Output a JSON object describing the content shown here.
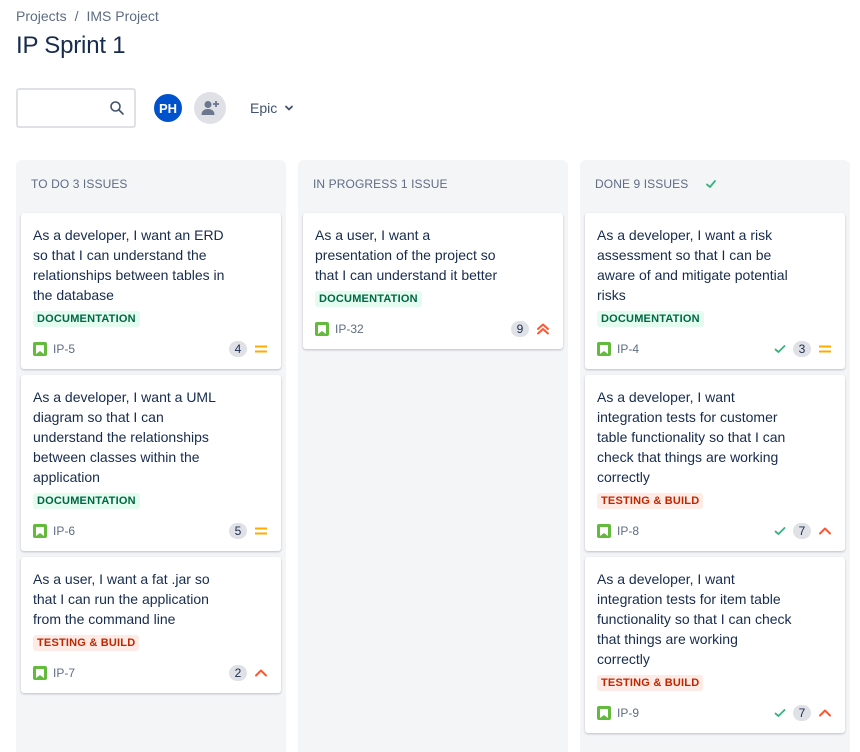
{
  "breadcrumb": {
    "items": [
      "Projects",
      "IMS Project"
    ],
    "separator": "/"
  },
  "page": {
    "title": "IP Sprint 1"
  },
  "toolbar": {
    "search_value": "",
    "avatar_initials": "PH",
    "epic_label": "Epic"
  },
  "colors": {
    "story": "#63ba3c",
    "avatar": "#0052cc",
    "priority_medium": "#ffab00",
    "priority_high": "#ff5630",
    "done": "#36b37e"
  },
  "columns": [
    {
      "title": "TO DO 3 ISSUES",
      "cards": [
        {
          "summary": "As a developer, I want an ERD so that I can understand the relationships between tables in the database",
          "label": "DOCUMENTATION",
          "key": "IP-5",
          "points": "4",
          "priority": "medium",
          "done": false
        },
        {
          "summary": "As a developer, I want a UML diagram so that I can understand the relationships between classes within the application",
          "label": "DOCUMENTATION",
          "key": "IP-6",
          "points": "5",
          "priority": "medium",
          "done": false
        },
        {
          "summary": "As a user, I want a fat .jar so that I can run the application from the command line",
          "label": "TESTING & BUILD",
          "key": "IP-7",
          "points": "2",
          "priority": "high",
          "done": false
        }
      ]
    },
    {
      "title": "IN PROGRESS 1 ISSUE",
      "cards": [
        {
          "summary": "As a user, I want a presentation of the project so that I can understand it better",
          "label": "DOCUMENTATION",
          "key": "IP-32",
          "points": "9",
          "priority": "highest",
          "done": false
        }
      ]
    },
    {
      "title": "DONE 9 ISSUES",
      "cards": [
        {
          "summary": "As a developer, I want a risk assessment so that I can be aware of and mitigate potential risks",
          "label": "DOCUMENTATION",
          "key": "IP-4",
          "points": "3",
          "priority": "medium",
          "done": true
        },
        {
          "summary": "As a developer, I want integration tests for customer table functionality so that I can check that things are working correctly",
          "label": "TESTING & BUILD",
          "key": "IP-8",
          "points": "7",
          "priority": "high",
          "done": true
        },
        {
          "summary": "As a developer, I want integration tests for item table functionality so that I can check that things are working correctly",
          "label": "TESTING & BUILD",
          "key": "IP-9",
          "points": "7",
          "priority": "high",
          "done": true
        }
      ]
    }
  ]
}
